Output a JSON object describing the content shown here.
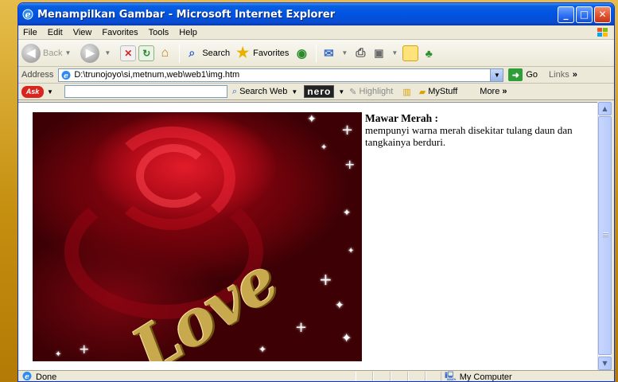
{
  "window": {
    "title": "Menampilkan Gambar - Microsoft Internet Explorer",
    "controls": {
      "minimize": "_",
      "maximize": "□",
      "close": "✕"
    }
  },
  "menu": [
    "File",
    "Edit",
    "View",
    "Favorites",
    "Tools",
    "Help"
  ],
  "toolbar": {
    "back": "Back",
    "search": "Search",
    "favorites": "Favorites"
  },
  "address": {
    "label": "Address",
    "url": "D:\\trunojoyo\\si,metnum,web\\web1\\img.htm",
    "go": "Go",
    "links": "Links"
  },
  "ask_toolbar": {
    "logo": "Ask",
    "search_web": "Search Web",
    "nero": "nero",
    "highlight": "Highlight",
    "mystuff": "MyStuff",
    "more": "More"
  },
  "page": {
    "image_text": "Love",
    "caption_title": "Mawar Merah :",
    "caption_body": "mempunyi warna merah disekitar tulang daun dan tangkainya berduri."
  },
  "status": {
    "text": "Done",
    "zone": "My Computer"
  },
  "colors": {
    "titlebar": "#0054e3",
    "backdrop": "#c58f10",
    "chrome": "#ece9d8"
  }
}
